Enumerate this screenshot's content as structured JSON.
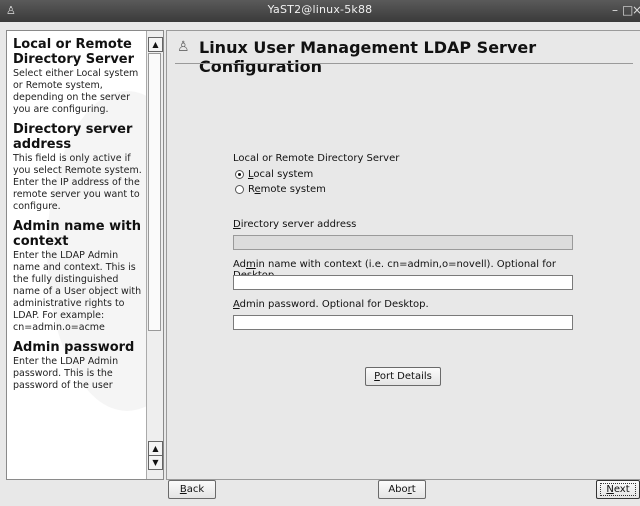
{
  "window": {
    "title": "YaST2@linux-5k88",
    "app_icon": "suse-icon",
    "controls": [
      "minimize",
      "maximize",
      "close"
    ]
  },
  "help": {
    "sections": [
      {
        "heading": "Local or Remote Directory Server",
        "text": "Select either Local system or Remote system, depending on the server you are configuring."
      },
      {
        "heading": "Directory server address",
        "text": "This field is only active if you select Remote system. Enter the IP address of the remote server you want to configure."
      },
      {
        "heading": "Admin name with context",
        "text": "Enter the LDAP Admin name and context. This is the fully distinguished name of a User object with administrative rights to LDAP. For example: cn=admin.o=acme"
      },
      {
        "heading": "Admin password",
        "text": "Enter the LDAP Admin password. This is the password of the user"
      }
    ]
  },
  "main": {
    "header_icon": "users-icon",
    "title": "Linux User Management LDAP Server Configuration",
    "server_group": {
      "label": "Local or Remote Directory Server",
      "options": [
        {
          "label_pre": "",
          "label_u": "L",
          "label_post": "ocal system",
          "selected": true
        },
        {
          "label_pre": "R",
          "label_u": "e",
          "label_post": "mote system",
          "selected": false
        }
      ]
    },
    "fields": {
      "address": {
        "label_pre": "",
        "label_u": "D",
        "label_post": "irectory server address",
        "value": "",
        "enabled": false
      },
      "admin": {
        "label_pre": "Ad",
        "label_u": "m",
        "label_post": "in name with context (i.e. cn=admin,o=novell). Optional for Desktop.",
        "value": "",
        "enabled": true
      },
      "password": {
        "label_pre": "",
        "label_u": "A",
        "label_post": "dmin password. Optional for Desktop.",
        "value": "",
        "enabled": true
      }
    },
    "port_button": {
      "label_pre": "",
      "label_u": "P",
      "label_post": "ort Details"
    }
  },
  "footer": {
    "back": {
      "label_pre": "",
      "label_u": "B",
      "label_post": "ack"
    },
    "abort": {
      "label_pre": "Abo",
      "label_u": "r",
      "label_post": "t"
    },
    "next": {
      "label_pre": "",
      "label_u": "N",
      "label_post": "ext"
    }
  }
}
